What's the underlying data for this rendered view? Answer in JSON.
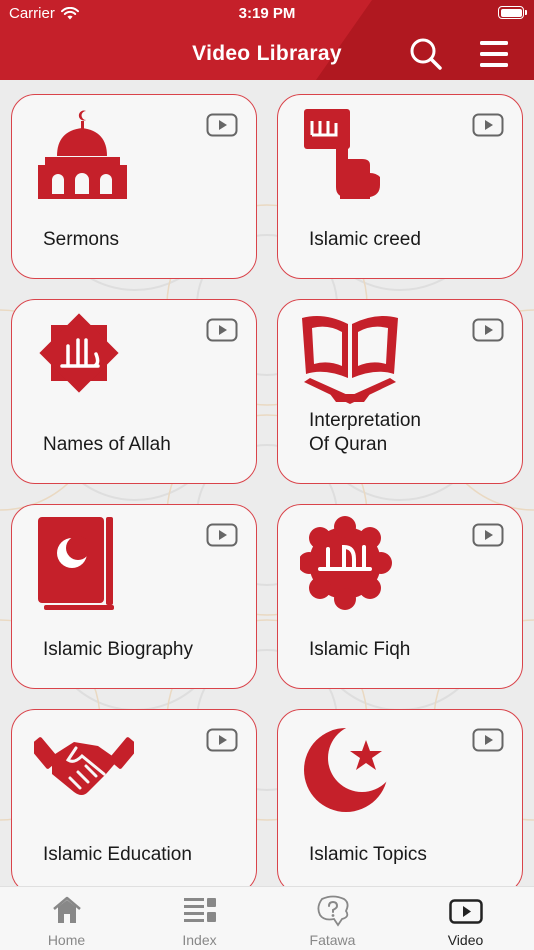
{
  "status_bar": {
    "carrier": "Carrier",
    "time": "3:19 PM"
  },
  "header": {
    "title": "Video Libraray"
  },
  "cards": [
    {
      "label": "Sermons",
      "icon": "mosque-icon"
    },
    {
      "label": "Islamic creed",
      "icon": "finger-pointing-icon"
    },
    {
      "label": "Names of Allah",
      "icon": "allah-star-icon"
    },
    {
      "label": "Interpretation\nOf Quran",
      "icon": "quran-stand-icon"
    },
    {
      "label": "Islamic Biography",
      "icon": "book-crescent-icon"
    },
    {
      "label": "Islamic Fiqh",
      "icon": "halal-badge-icon"
    },
    {
      "label": "Islamic Education",
      "icon": "handshake-icon"
    },
    {
      "label": "Islamic Topics",
      "icon": "crescent-star-icon"
    }
  ],
  "tabs": [
    {
      "label": "Home",
      "icon": "home-icon",
      "active": false
    },
    {
      "label": "Index",
      "icon": "index-icon",
      "active": false
    },
    {
      "label": "Fatawa",
      "icon": "fatawa-icon",
      "active": false
    },
    {
      "label": "Video",
      "icon": "video-icon",
      "active": true
    }
  ],
  "colors": {
    "brand": "#c5202a",
    "card_border": "#d9434a",
    "icon_red": "#c5202a"
  }
}
